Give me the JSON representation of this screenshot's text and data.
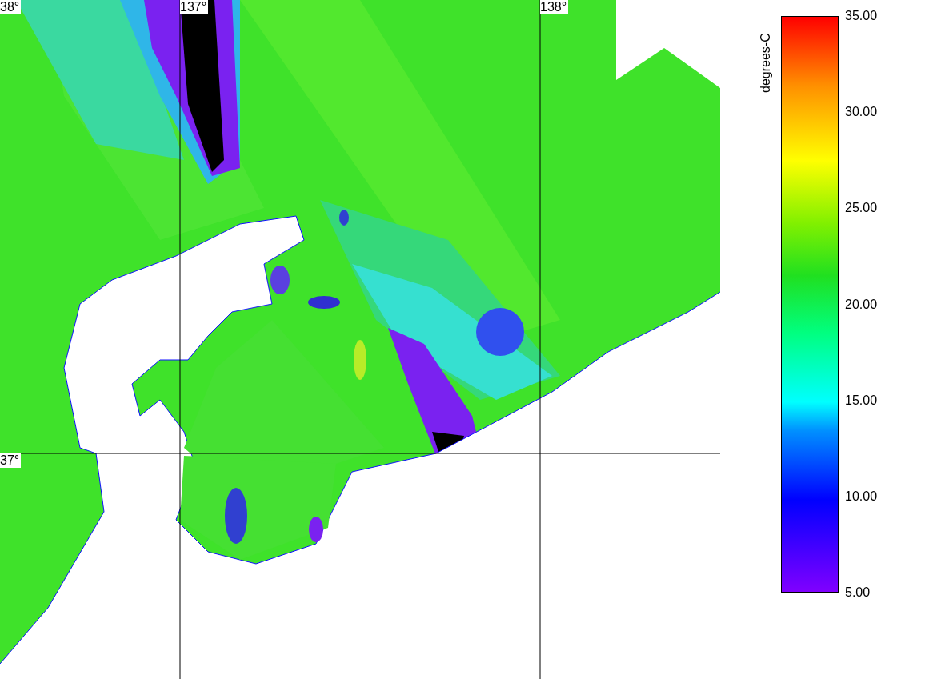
{
  "map": {
    "grid_labels": [
      {
        "text": "38°",
        "kind": "lat"
      },
      {
        "text": "137°",
        "kind": "lon"
      },
      {
        "text": "138°",
        "kind": "lon"
      },
      {
        "text": "37°",
        "kind": "lat"
      }
    ]
  },
  "colorbar": {
    "title": "degrees-C",
    "ticks": [
      "35.00",
      "30.00",
      "25.00",
      "20.00",
      "15.00",
      "10.00",
      "5.00"
    ]
  }
}
